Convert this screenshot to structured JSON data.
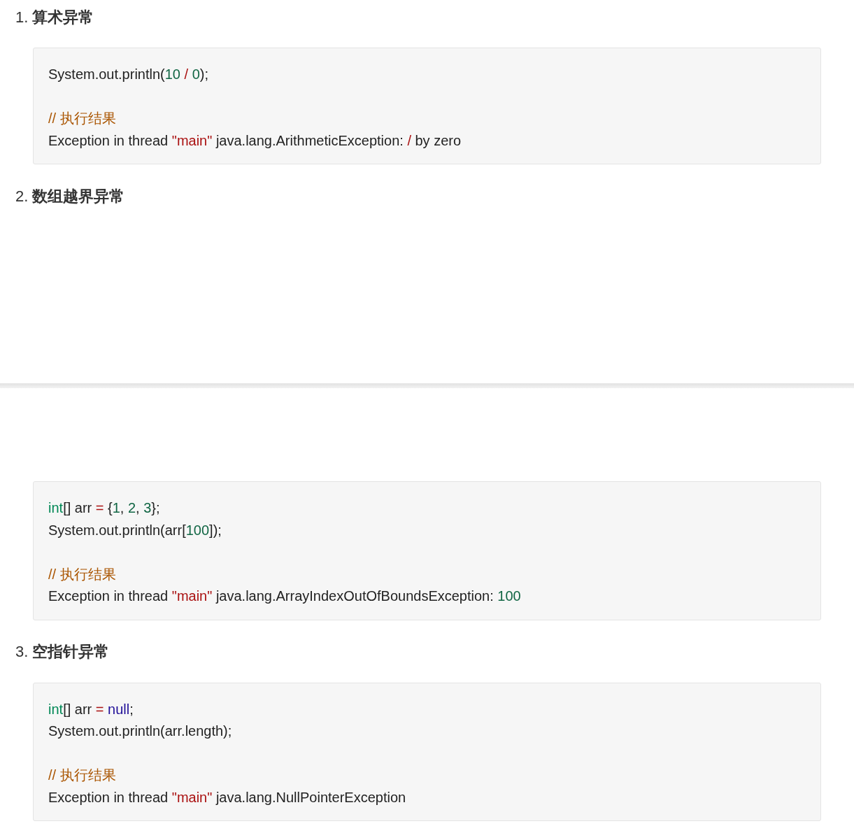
{
  "content": [
    {
      "kind": "heading",
      "number": "1.",
      "title": "算术异常"
    },
    {
      "kind": "code",
      "groups": [
        [
          [
            {
              "kind": "plain",
              "text": "System.out.println("
            },
            {
              "kind": "number",
              "text": "10"
            },
            {
              "kind": "operator",
              "text": " / "
            },
            {
              "kind": "number",
              "text": "0"
            },
            {
              "kind": "plain",
              "text": ");"
            }
          ]
        ],
        [
          [
            {
              "kind": "comment",
              "text": "// 执行结果"
            }
          ],
          [
            {
              "kind": "plain",
              "text": "Exception in thread "
            },
            {
              "kind": "string",
              "text": "\"main\""
            },
            {
              "kind": "plain",
              "text": " java.lang.ArithmeticException: "
            },
            {
              "kind": "operator",
              "text": "/"
            },
            {
              "kind": "plain",
              "text": " by zero"
            }
          ]
        ]
      ]
    },
    {
      "kind": "heading",
      "number": "2.",
      "title": "数组越界异常"
    },
    {
      "kind": "page_break"
    },
    {
      "kind": "code",
      "groups": [
        [
          [
            {
              "kind": "type",
              "text": "int"
            },
            {
              "kind": "plain",
              "text": "[] arr "
            },
            {
              "kind": "operator",
              "text": "="
            },
            {
              "kind": "plain",
              "text": " {"
            },
            {
              "kind": "number",
              "text": "1"
            },
            {
              "kind": "plain",
              "text": ", "
            },
            {
              "kind": "number",
              "text": "2"
            },
            {
              "kind": "plain",
              "text": ", "
            },
            {
              "kind": "number",
              "text": "3"
            },
            {
              "kind": "plain",
              "text": "};"
            }
          ],
          [
            {
              "kind": "plain",
              "text": "System.out.println(arr["
            },
            {
              "kind": "number",
              "text": "100"
            },
            {
              "kind": "plain",
              "text": "]);"
            }
          ]
        ],
        [
          [
            {
              "kind": "comment",
              "text": "// 执行结果"
            }
          ],
          [
            {
              "kind": "plain",
              "text": "Exception in thread "
            },
            {
              "kind": "string",
              "text": "\"main\""
            },
            {
              "kind": "plain",
              "text": " java.lang.ArrayIndexOutOfBoundsException: "
            },
            {
              "kind": "number",
              "text": "100"
            }
          ]
        ]
      ]
    },
    {
      "kind": "heading",
      "number": "3.",
      "title": "空指针异常"
    },
    {
      "kind": "code",
      "groups": [
        [
          [
            {
              "kind": "type",
              "text": "int"
            },
            {
              "kind": "plain",
              "text": "[] arr "
            },
            {
              "kind": "operator",
              "text": "= "
            },
            {
              "kind": "literal",
              "text": "null"
            },
            {
              "kind": "plain",
              "text": ";"
            }
          ],
          [
            {
              "kind": "plain",
              "text": "System.out.println(arr.length);"
            }
          ]
        ],
        [
          [
            {
              "kind": "comment",
              "text": "// 执行结果"
            }
          ],
          [
            {
              "kind": "plain",
              "text": "Exception in thread "
            },
            {
              "kind": "string",
              "text": "\"main\""
            },
            {
              "kind": "plain",
              "text": " java.lang.NullPointerException"
            }
          ]
        ]
      ]
    }
  ]
}
